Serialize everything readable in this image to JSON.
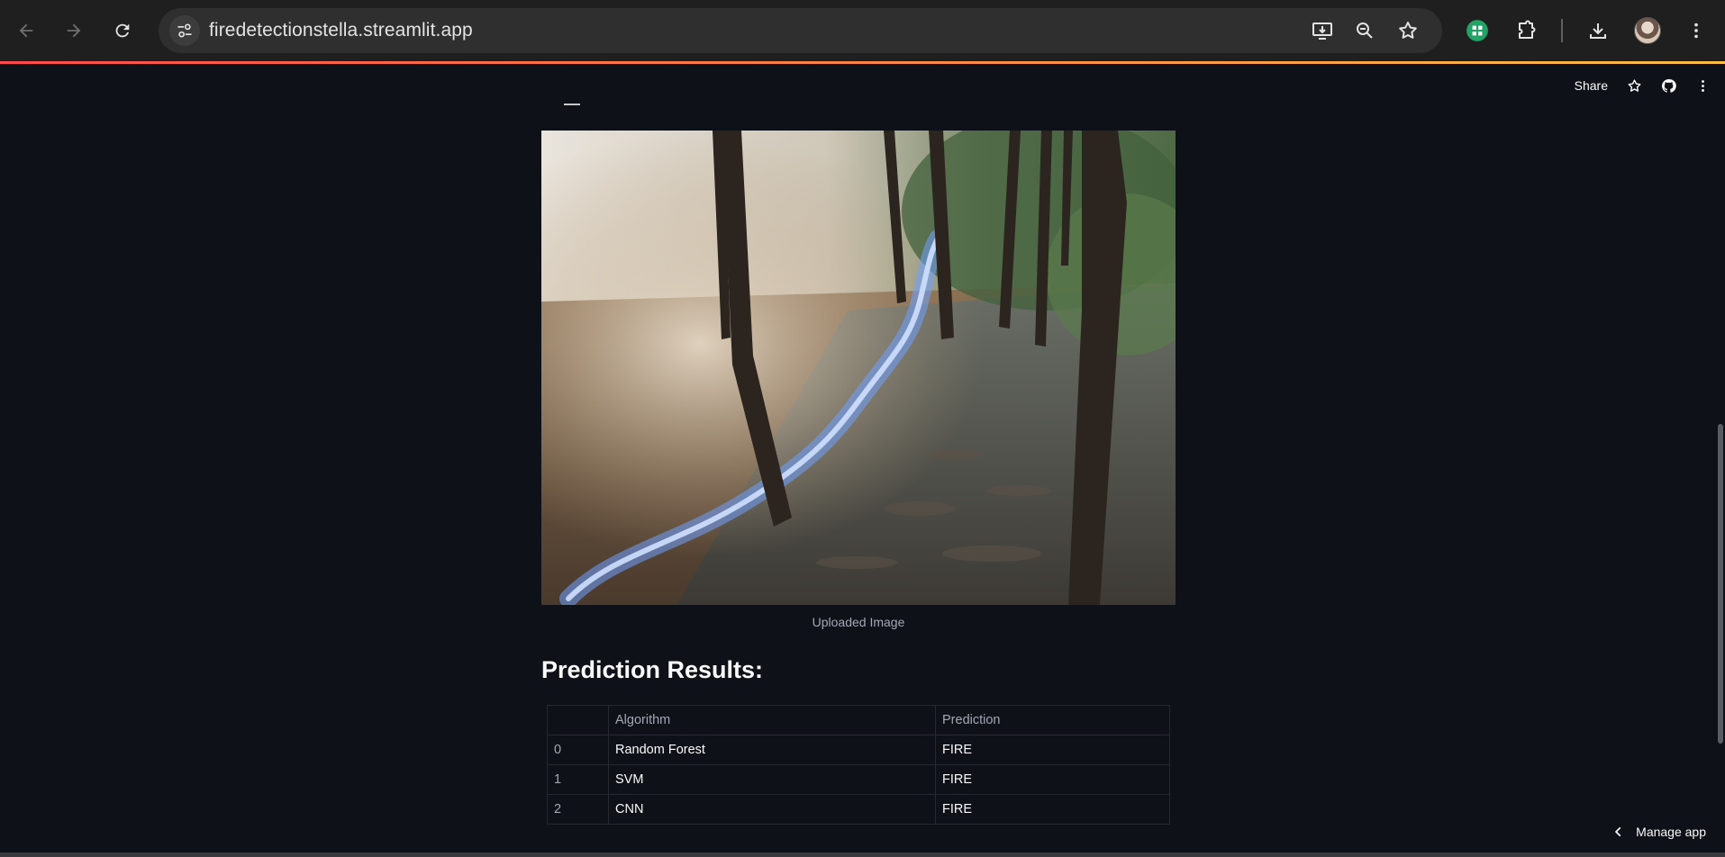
{
  "browser": {
    "url": "firedetectionstella.streamlit.app"
  },
  "toolbar": {
    "share_label": "Share"
  },
  "image": {
    "caption": "Uploaded Image"
  },
  "results": {
    "heading": "Prediction Results:",
    "columns": [
      "",
      "Algorithm",
      "Prediction"
    ],
    "rows": [
      {
        "index": "0",
        "algorithm": "Random Forest",
        "prediction": "FIRE"
      },
      {
        "index": "1",
        "algorithm": "SVM",
        "prediction": "FIRE"
      },
      {
        "index": "2",
        "algorithm": "CNN",
        "prediction": "FIRE"
      }
    ]
  },
  "footer": {
    "manage_label": "Manage app"
  },
  "colors": {
    "background": "#0e1117",
    "chrome": "#1f1f1f",
    "accent_gradient_start": "#ff4b4b",
    "accent_gradient_end": "#ffbd45"
  }
}
